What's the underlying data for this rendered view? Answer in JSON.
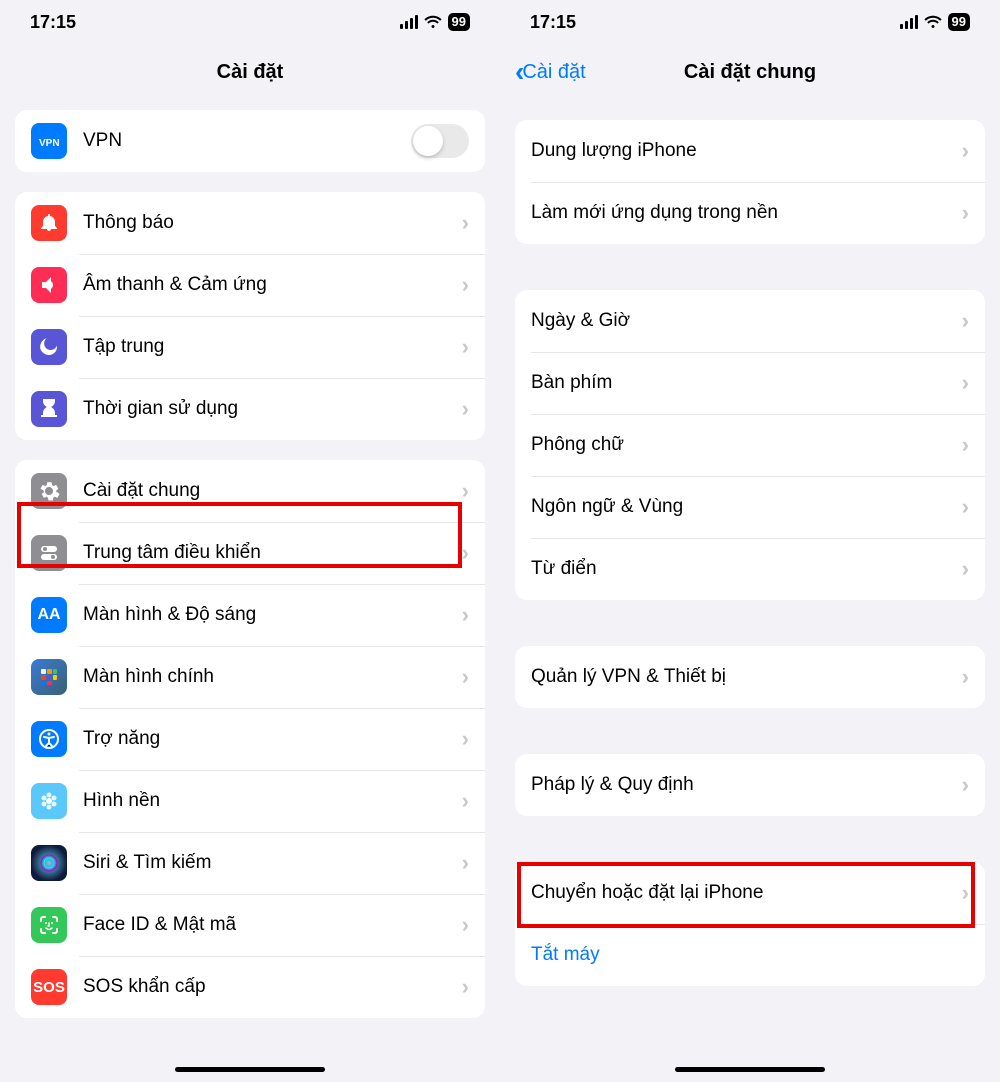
{
  "status": {
    "time": "17:15",
    "battery": "99"
  },
  "left": {
    "title": "Cài đặt",
    "group0": {
      "vpn": "VPN"
    },
    "group1": {
      "notifications": "Thông báo",
      "sounds": "Âm thanh & Cảm ứng",
      "focus": "Tập trung",
      "screentime": "Thời gian sử dụng"
    },
    "group2": {
      "general": "Cài đặt chung",
      "control_center": "Trung tâm điều khiển",
      "display": "Màn hình & Độ sáng",
      "home_screen": "Màn hình chính",
      "accessibility": "Trợ năng",
      "wallpaper": "Hình nền",
      "siri": "Siri & Tìm kiếm",
      "faceid": "Face ID & Mật mã",
      "sos": "SOS khẩn cấp"
    }
  },
  "right": {
    "back": "Cài đặt",
    "title": "Cài đặt chung",
    "group0": {
      "storage": "Dung lượng iPhone",
      "background_refresh": "Làm mới ứng dụng trong nền"
    },
    "group1": {
      "date_time": "Ngày & Giờ",
      "keyboard": "Bàn phím",
      "fonts": "Phông chữ",
      "language": "Ngôn ngữ & Vùng",
      "dictionary": "Từ điển"
    },
    "group2": {
      "vpn_device": "Quản lý VPN & Thiết bị"
    },
    "group3": {
      "legal": "Pháp lý & Quy định"
    },
    "group4": {
      "transfer_reset": "Chuyển hoặc đặt lại iPhone"
    },
    "group5": {
      "shutdown": "Tắt máy"
    }
  }
}
